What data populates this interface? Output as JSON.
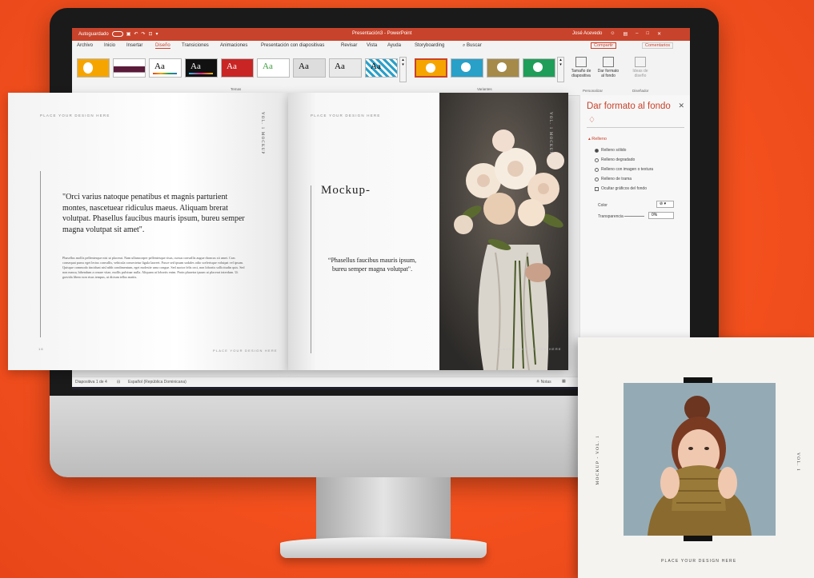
{
  "ppt": {
    "autosave_label": "Autoguardado",
    "title": "Presentación3 - PowerPoint",
    "user": "José Acevedo",
    "menu": [
      "Archivo",
      "Inicio",
      "Insertar",
      "Diseño",
      "Transiciones",
      "Animaciones",
      "Presentación con diapositivas",
      "Revisar",
      "Vista",
      "Ayuda",
      "Storyboarding"
    ],
    "search_label": "Buscar",
    "share_label": "Compartir",
    "comments_label": "Comentarios",
    "themes_group": "Temas",
    "variants_group": "Variantes",
    "customize_group": "Personalizar",
    "designer_group": "Diseñador",
    "slide_size_label": "Tamaño de diapositiva",
    "format_bg_label": "Dar formato al fondo",
    "design_ideas_label": "Ideas de diseño",
    "theme_glyph": "Aa",
    "panel": {
      "title": "Dar formato al fondo",
      "section": "Relleno",
      "options": [
        "Relleno sólido",
        "Relleno degradado",
        "Relleno con imagen o textura",
        "Relleno de trama"
      ],
      "hide_graphics": "Ocultar gráficos del fondo",
      "color_label": "Color",
      "transparency_label": "Transparencia",
      "transparency_value": "0%"
    },
    "status": {
      "slide": "Diapositiva 1 de 4",
      "language": "Español (República Dominicana)",
      "notes": "Notas"
    }
  },
  "book": {
    "left_header": "PLACE YOUR DESIGN HERE",
    "left_spine": "VOL. 1   MOCKUP",
    "left_quote": "\"Orci varius natoque penatibus et magnis parturient montes, nascetuear ridiculus maeus. Aliquam brerat volutpat. Phasellus faucibus mauris ipsum, bureu semper magna volutpat sit amet\".",
    "left_body": "Phasellus mollis pellentesque nisi ut placerat. Nam ullamcorper pellentesque risus, cursus convallis augue rhoncus sit amet. Cras consequat purus eget lectus convallis, vehicula consectetur ligula laoreet. Fusce sed ipsum sodales odio scelerisque volutpat vel ipsum. Quisque commodo tincidunt nisl nibh condimentum, eget molestie urna congue. Sed auctor felis orci, non lobortis sollicitudin quis. Sed non massa, bibendum a ornare vitae, mollis pulvinar nulla. Aliquam ut lobortis enim. Proin pharetra ipsum ut placerat interdum. Ut gravida libero non risus tempus, ut dictum tellus mattis.",
    "left_page_num": "16",
    "left_footer": "PLACE YOUR DESIGN HERE",
    "right_header": "PLACE YOUR DESIGN HERE",
    "right_title": "Mockup-",
    "right_quote": "Phasellus faucibus mauris ipsum, bureu semper magna volutpat\".",
    "right_spine": "VOL. 1   MOCKUP",
    "right_footer": "PLACE YOUR DESIGN HERE"
  },
  "card": {
    "spine_left": "MOCKUP - VOL. 1",
    "spine_right": "VOL. 1",
    "footer": "PLACE YOUR DESIGN HERE"
  },
  "colors": {
    "brand": "#c8432b",
    "background": "#f4511e"
  }
}
